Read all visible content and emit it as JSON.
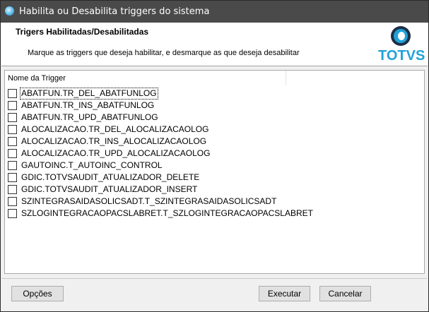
{
  "window": {
    "title": "Habilita ou Desabilita triggers do sistema"
  },
  "header": {
    "title": "Trigers Habilitadas/Desabilitadas",
    "description": "Marque as triggers que deseja habilitar, e desmarque as que deseja desabilitar",
    "logo_text": "TOTVS"
  },
  "list": {
    "column_header": "Nome da Trigger",
    "items": [
      {
        "label": "ABATFUN.TR_DEL_ABATFUNLOG",
        "checked": false
      },
      {
        "label": "ABATFUN.TR_INS_ABATFUNLOG",
        "checked": false
      },
      {
        "label": "ABATFUN.TR_UPD_ABATFUNLOG",
        "checked": false
      },
      {
        "label": "ALOCALIZACAO.TR_DEL_ALOCALIZACAOLOG",
        "checked": false
      },
      {
        "label": "ALOCALIZACAO.TR_INS_ALOCALIZACAOLOG",
        "checked": false
      },
      {
        "label": "ALOCALIZACAO.TR_UPD_ALOCALIZACAOLOG",
        "checked": false
      },
      {
        "label": "GAUTOINC.T_AUTOINC_CONTROL",
        "checked": false
      },
      {
        "label": "GDIC.TOTVSAUDIT_ATUALIZADOR_DELETE",
        "checked": false
      },
      {
        "label": "GDIC.TOTVSAUDIT_ATUALIZADOR_INSERT",
        "checked": false
      },
      {
        "label": "SZINTEGRASAIDASOLICSADT.T_SZINTEGRASAIDASOLICSADT",
        "checked": false
      },
      {
        "label": "SZLOGINTEGRACAOPACSLABRET.T_SZLOGINTEGRACAOPACSLABRET",
        "checked": false
      }
    ]
  },
  "footer": {
    "options_label": "Opções",
    "execute_label": "Executar",
    "cancel_label": "Cancelar"
  }
}
